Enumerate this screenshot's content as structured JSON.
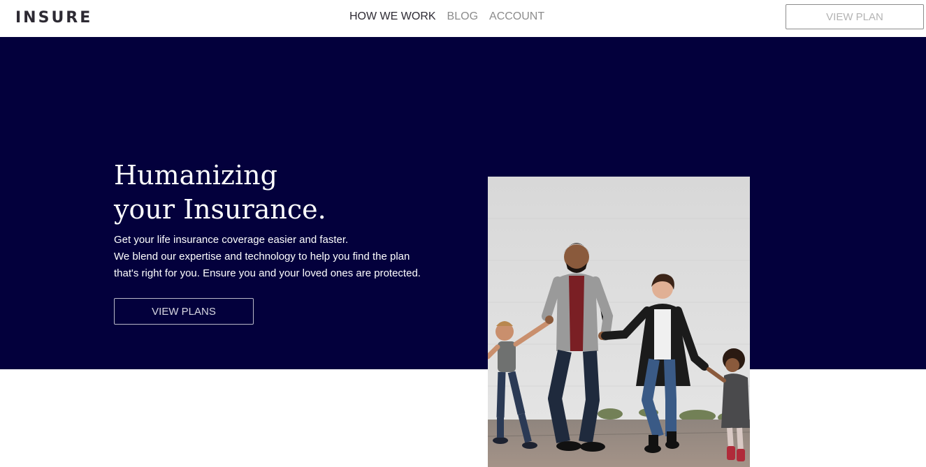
{
  "header": {
    "logo": "INSURE",
    "nav": [
      {
        "label": "HOW WE WORK",
        "active": true
      },
      {
        "label": "BLOG",
        "active": false
      },
      {
        "label": "ACCOUNT",
        "active": false
      }
    ],
    "cta_label": "VIEW PLAN"
  },
  "hero": {
    "title_line1": "Humanizing",
    "title_line2": "your Insurance.",
    "text_line1": "Get your life insurance coverage easier and faster.",
    "text_line2": "We blend our expertise and technology to help you find the plan",
    "text_line3": "that's right for you. Ensure you and your loved ones are protected.",
    "cta_label": "VIEW PLANS"
  },
  "colors": {
    "hero_background": "#03003c",
    "text_dark": "#2d2a33",
    "nav_muted": "#8c8c8c"
  },
  "icons": [
    "family-photo"
  ]
}
